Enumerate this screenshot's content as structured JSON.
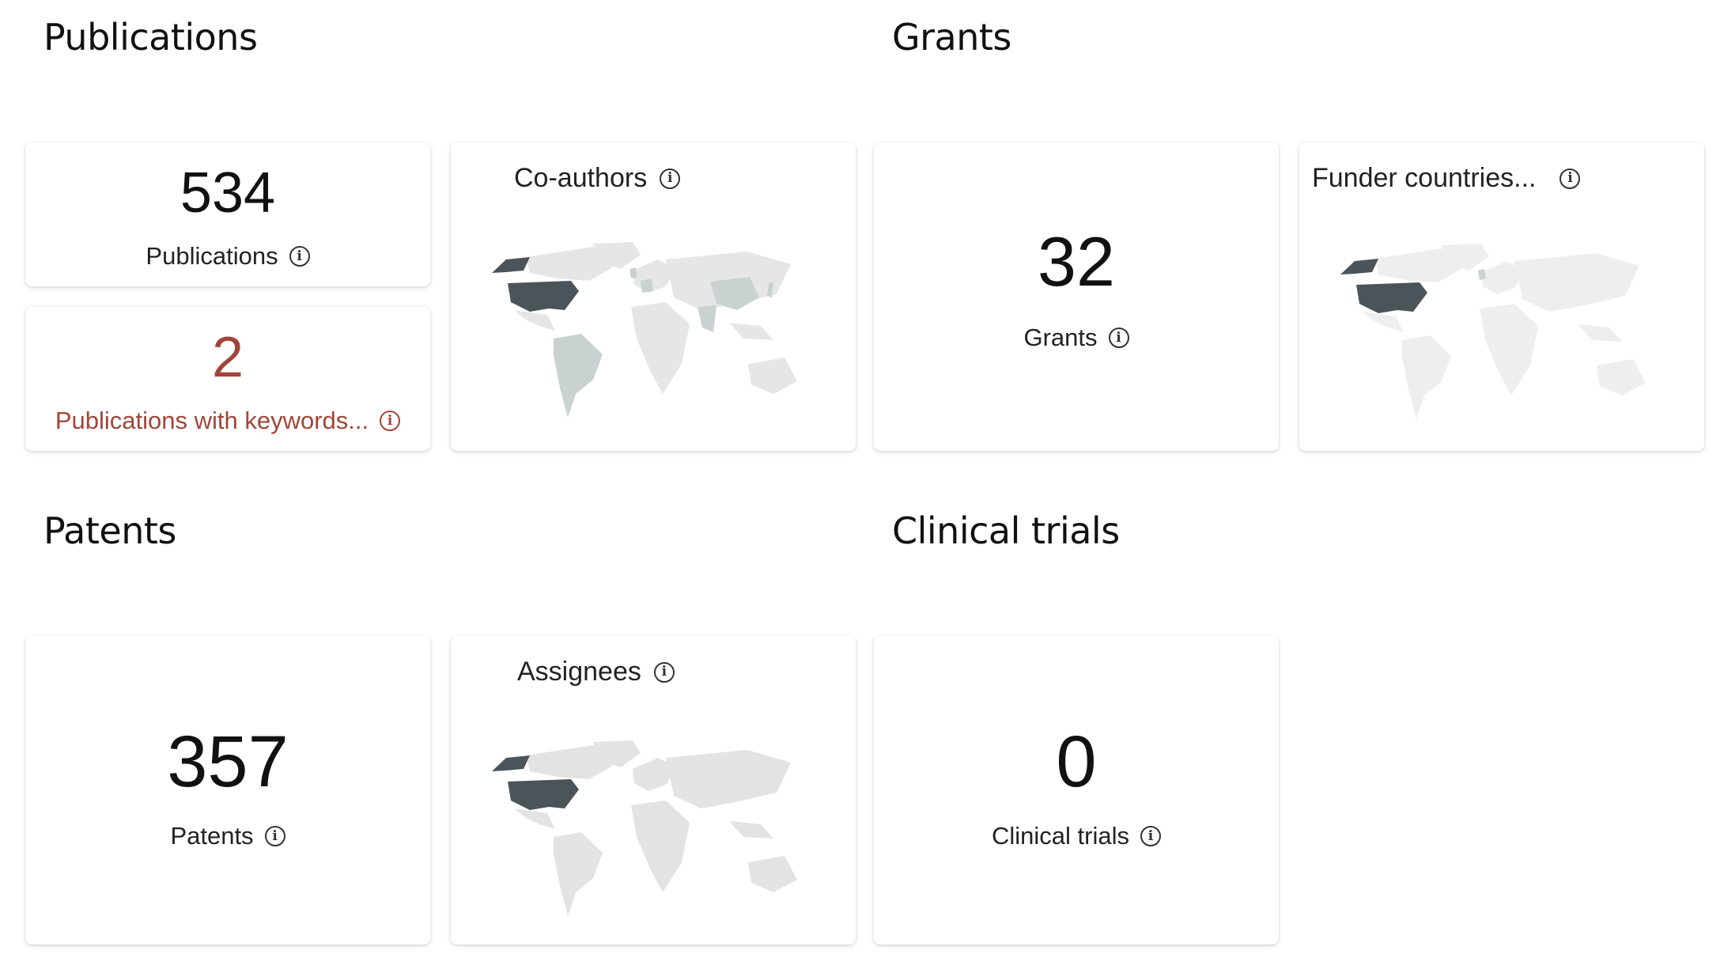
{
  "sections": {
    "publications": "Publications",
    "grants": "Grants",
    "patents": "Patents",
    "clinical_trials": "Clinical trials"
  },
  "publications_card": {
    "value": "534",
    "label": "Publications"
  },
  "keywords_card": {
    "value": "2",
    "label": "Publications with keywords..."
  },
  "coauthors_card": {
    "title": "Co-authors"
  },
  "grants_card": {
    "value": "32",
    "label": "Grants"
  },
  "funder_card": {
    "title": "Funder countries..."
  },
  "patents_card": {
    "value": "357",
    "label": "Patents"
  },
  "assignees_card": {
    "title": "Assignees"
  },
  "clinical_card": {
    "value": "0",
    "label": "Clinical trials"
  },
  "icons": {
    "info": "i"
  },
  "colors": {
    "accent": "#a14538",
    "map_highlight": "#4a5459",
    "map_secondary": "#c9d2d0",
    "map_base": "#e6e6e6"
  }
}
